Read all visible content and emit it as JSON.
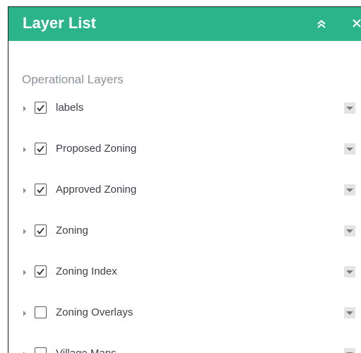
{
  "header": {
    "title": "Layer List",
    "collapse_icon": "double-chevron-up-icon",
    "close_icon": "close-icon",
    "color": "#2bb38a"
  },
  "section": {
    "title": "Operational Layers"
  },
  "layers": [
    {
      "label": "labels",
      "checked": true
    },
    {
      "label": "Proposed Zoning",
      "checked": true
    },
    {
      "label": "Approved Zoning",
      "checked": true
    },
    {
      "label": "Zoning",
      "checked": true
    },
    {
      "label": "Zoning Index",
      "checked": true
    },
    {
      "label": "Zoning Overlays",
      "checked": false
    },
    {
      "label": "Village Maps",
      "checked": false
    }
  ]
}
